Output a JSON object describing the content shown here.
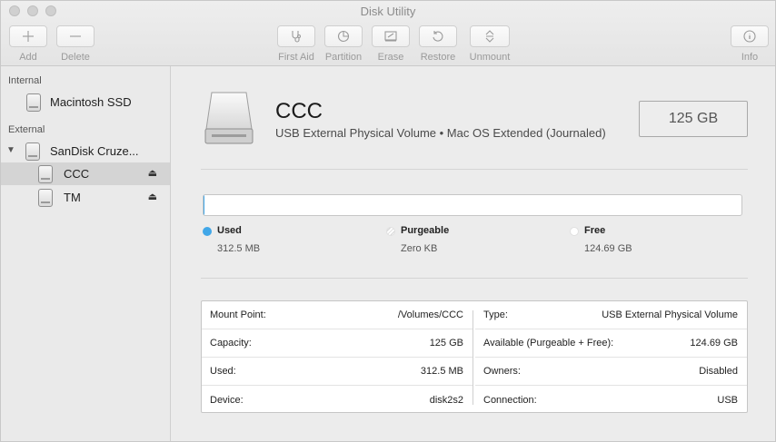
{
  "window": {
    "title": "Disk Utility"
  },
  "toolbar": {
    "add_label": "Add",
    "delete_label": "Delete",
    "first_aid_label": "First Aid",
    "partition_label": "Partition",
    "erase_label": "Erase",
    "restore_label": "Restore",
    "unmount_label": "Unmount",
    "info_label": "Info"
  },
  "sidebar": {
    "internal_header": "Internal",
    "external_header": "External",
    "items": [
      {
        "label": "Macintosh SSD",
        "section": "internal",
        "selected": false
      },
      {
        "label": "SanDisk Cruze...",
        "section": "external",
        "selected": false
      },
      {
        "label": "CCC",
        "section": "external",
        "selected": true,
        "eject": "⏏"
      },
      {
        "label": "TM",
        "section": "external",
        "selected": false,
        "eject": "⏏"
      }
    ]
  },
  "volume": {
    "name": "CCC",
    "description": "USB External Physical Volume • Mac OS Extended (Journaled)",
    "capacity_display": "125 GB"
  },
  "usage": {
    "used_fraction": 0.0025,
    "legend": [
      {
        "name": "Used",
        "value": "312.5 MB",
        "color": "#41a7e8"
      },
      {
        "name": "Purgeable",
        "value": "Zero KB",
        "color": "#ffffff"
      },
      {
        "name": "Free",
        "value": "124.69 GB",
        "color": "#ffffff"
      }
    ]
  },
  "info_left": [
    {
      "label": "Mount Point:",
      "value": "/Volumes/CCC"
    },
    {
      "label": "Capacity:",
      "value": "125 GB"
    },
    {
      "label": "Used:",
      "value": "312.5 MB"
    },
    {
      "label": "Device:",
      "value": "disk2s2"
    }
  ],
  "info_right": [
    {
      "label": "Type:",
      "value": "USB External Physical Volume"
    },
    {
      "label": "Available (Purgeable + Free):",
      "value": "124.69 GB"
    },
    {
      "label": "Owners:",
      "value": "Disabled"
    },
    {
      "label": "Connection:",
      "value": "USB"
    }
  ]
}
